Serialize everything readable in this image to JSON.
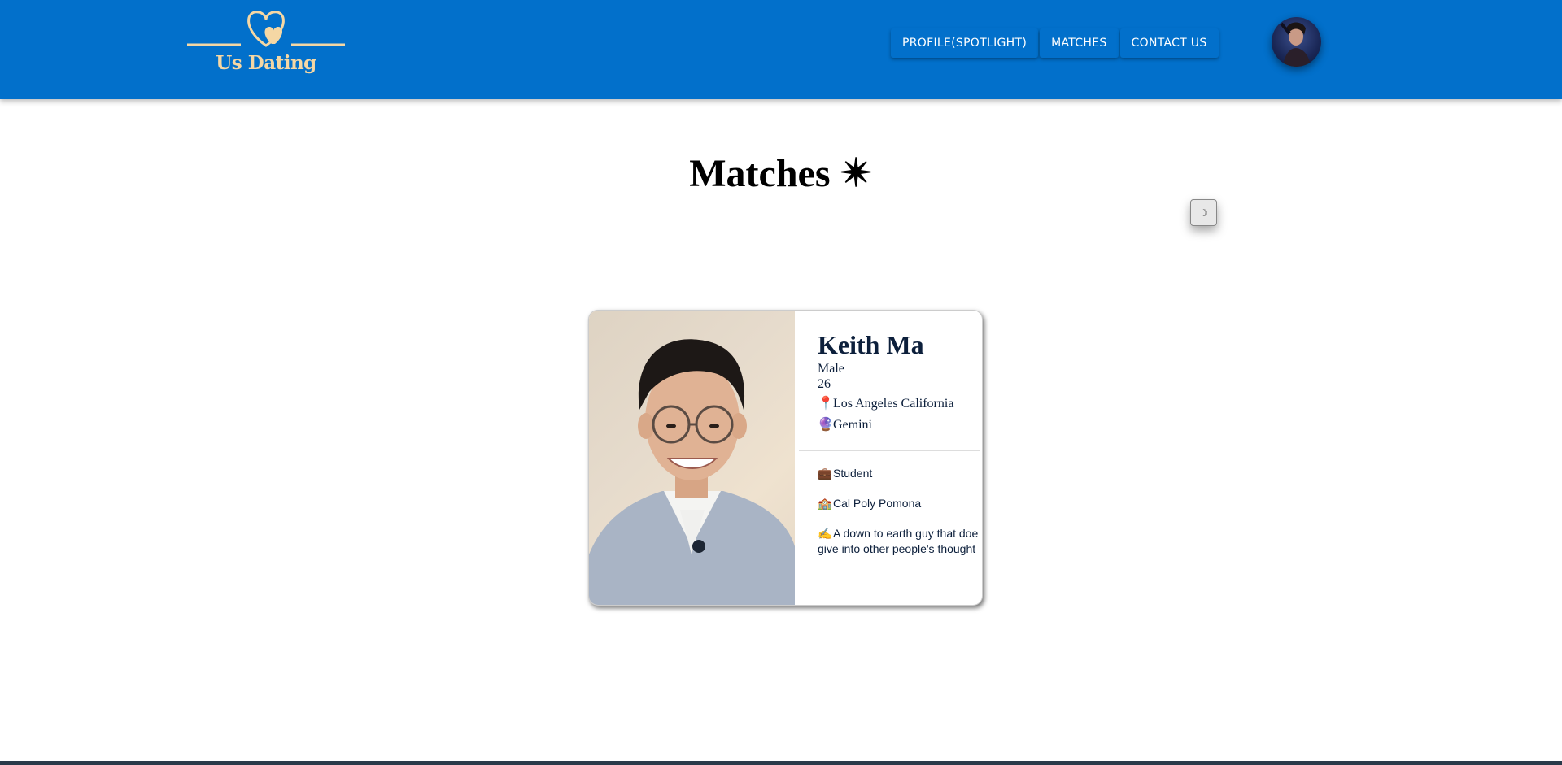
{
  "header": {
    "brand": "Us Dating",
    "nav": [
      {
        "label": "PROFILE(SPOTLIGHT)"
      },
      {
        "label": "MATCHES"
      },
      {
        "label": "CONTACT US"
      }
    ]
  },
  "main": {
    "title": "Matches ✴",
    "theme_toggle_icon": "☽"
  },
  "match_card": {
    "name": "Keith Ma",
    "gender": "Male",
    "age": "26",
    "location_icon": "📍",
    "location": "Los Angeles California",
    "zodiac_icon": "🔮",
    "zodiac": "Gemini",
    "occupation_icon": "💼",
    "occupation": "Student",
    "school_icon": "🏫",
    "school": "Cal Poly Pomona",
    "bio_icon": "✍️",
    "bio_line1": "A down to earth guy that doe",
    "bio_line2": "give into other people's thought"
  },
  "colors": {
    "header_bg": "#0270cb",
    "brand": "#f5d7a4",
    "card_text": "#0c1f3b"
  }
}
